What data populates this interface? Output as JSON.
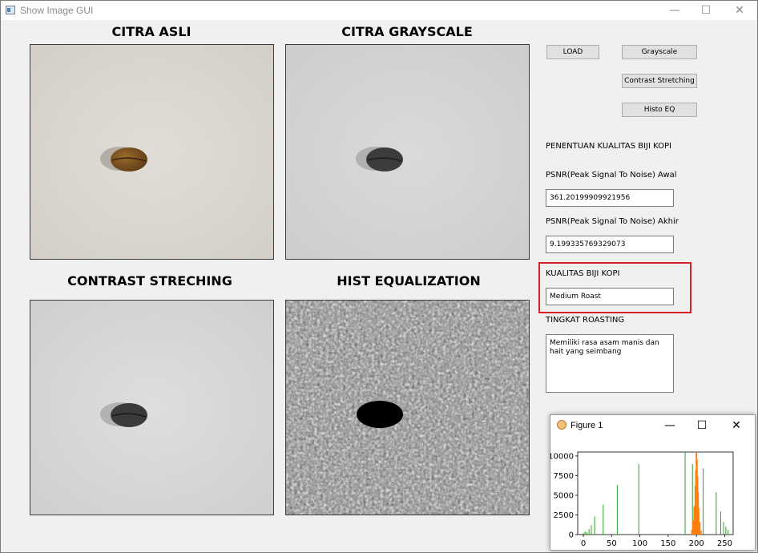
{
  "window": {
    "title": "Show Image GUI",
    "minimize_glyph": "—",
    "maximize_glyph": "☐",
    "close_glyph": "✕"
  },
  "panels": {
    "original_title": "CITRA ASLI",
    "grayscale_title": "CITRA GRAYSCALE",
    "contrast_title": "CONTRAST STRECHING",
    "histeq_title": "HIST EQUALIZATION"
  },
  "buttons": {
    "load": "LOAD",
    "grayscale": "Grayscale",
    "contrast": "Contrast Stretching",
    "histeq": "Histo EQ"
  },
  "quality": {
    "section_title": "PENENTUAN KUALITAS BIJI KOPI",
    "psnr_initial_label": "PSNR(Peak Signal To Noise) Awal",
    "psnr_initial_value": "361.20199909921956",
    "psnr_final_label": "PSNR(Peak Signal To Noise) Akhir",
    "psnr_final_value": "9.199335769329073",
    "kualitas_label": "KUALITAS BIJI KOPI",
    "kualitas_value": "Medium Roast",
    "tingkat_label": "TINGKAT ROASTING",
    "tingkat_value": "Memiliki rasa asam manis dan hait yang seimbang"
  },
  "figure": {
    "title": "Figure 1",
    "minimize_glyph": "—",
    "maximize_glyph": "☐",
    "close_glyph": "✕"
  },
  "colors": {
    "highlight": "#d42027",
    "hist_green": "#2ca02c",
    "hist_orange": "#ff7f0e"
  },
  "chart_data": {
    "type": "bar",
    "title": "",
    "xlabel": "",
    "ylabel": "",
    "xlim": [
      -10,
      265
    ],
    "ylim": [
      0,
      10500
    ],
    "y_ticks": [
      0,
      2500,
      5000,
      7500,
      10000
    ],
    "y_tick_labels": [
      "0",
      "2500",
      "5000",
      "7500",
      "10000"
    ],
    "x_ticks": [
      0,
      50,
      100,
      150,
      200,
      250
    ],
    "series": [
      {
        "color": "#2ca02c",
        "x": [
          0,
          3,
          6,
          10,
          14,
          20,
          35,
          60,
          98,
          180,
          193,
          212,
          235,
          243,
          248,
          252,
          256
        ],
        "y": [
          200,
          400,
          300,
          700,
          1200,
          2300,
          3800,
          6300,
          9000,
          10500,
          9000,
          8400,
          5400,
          2900,
          1600,
          1000,
          600
        ]
      },
      {
        "color": "#ff7f0e",
        "x": [
          192,
          194,
          196,
          198,
          199,
          200,
          201,
          202,
          203,
          204,
          206,
          208
        ],
        "y": [
          600,
          1800,
          3600,
          6200,
          8200,
          10400,
          9600,
          7400,
          5400,
          3400,
          1600,
          500
        ]
      }
    ]
  }
}
